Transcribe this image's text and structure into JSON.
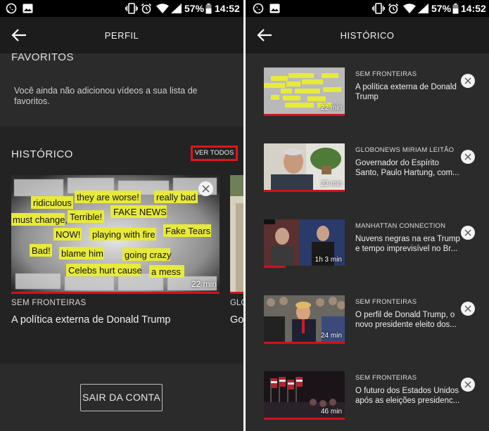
{
  "status_bar": {
    "battery": "57%",
    "time": "14:52"
  },
  "profile_screen": {
    "header": {
      "title": "PERFIL"
    },
    "favorites": {
      "title": "FAVORITOS",
      "empty_message": "Você ainda não adicionou vídeos a sua lista de favoritos."
    },
    "history": {
      "title": "HISTÓRICO",
      "see_all_label": "VER TODOS",
      "cards": [
        {
          "show": "SEM FRONTEIRAS",
          "title": "A política externa de Donald Trump",
          "duration": "22 min",
          "progress": 1.0,
          "thumb_words": [
            "they are worse!",
            "really bad",
            "ridiculous",
            "FAKE NEWS",
            "must change,",
            "Terrible!",
            "NOW!",
            "playing with fire",
            "Fake Tears",
            "Bad!",
            "blame him",
            "going crazy",
            "Celebs hurt cause",
            "a mess"
          ]
        },
        {
          "show": "GLO",
          "title": "Go"
        }
      ]
    },
    "logout_label": "SAIR DA CONTA"
  },
  "history_screen": {
    "header": {
      "title": "HISTÓRICO"
    },
    "items": [
      {
        "show": "SEM FRONTEIRAS",
        "title": "A política externa de Donald Trump",
        "duration": "22 min",
        "progress": 1.0
      },
      {
        "show": "GLOBONEWS MIRIAM LEITÃO",
        "title": "Governador do Espírito Santo, Paulo Hartung, com...",
        "duration": "23 min",
        "progress": 1.0
      },
      {
        "show": "MANHATTAN CONNECTION",
        "title": "Nuvens negras na era Trump e tempo imprevisível no Br...",
        "duration": "1h 3 min",
        "progress": 0.27
      },
      {
        "show": "SEM FRONTEIRAS",
        "title": "O perfil de Donald Trump, o novo presidente eleito dos...",
        "duration": "24 min",
        "progress": 1.0
      },
      {
        "show": "SEM FRONTEIRAS",
        "title": "O futuro dos Estados Unidos após as eleições presidenc...",
        "duration": "46 min",
        "progress": 1.0
      }
    ]
  },
  "colors": {
    "accent": "#d0121b",
    "background": "#2b2b2b",
    "appbar": "#1c1c1c"
  }
}
